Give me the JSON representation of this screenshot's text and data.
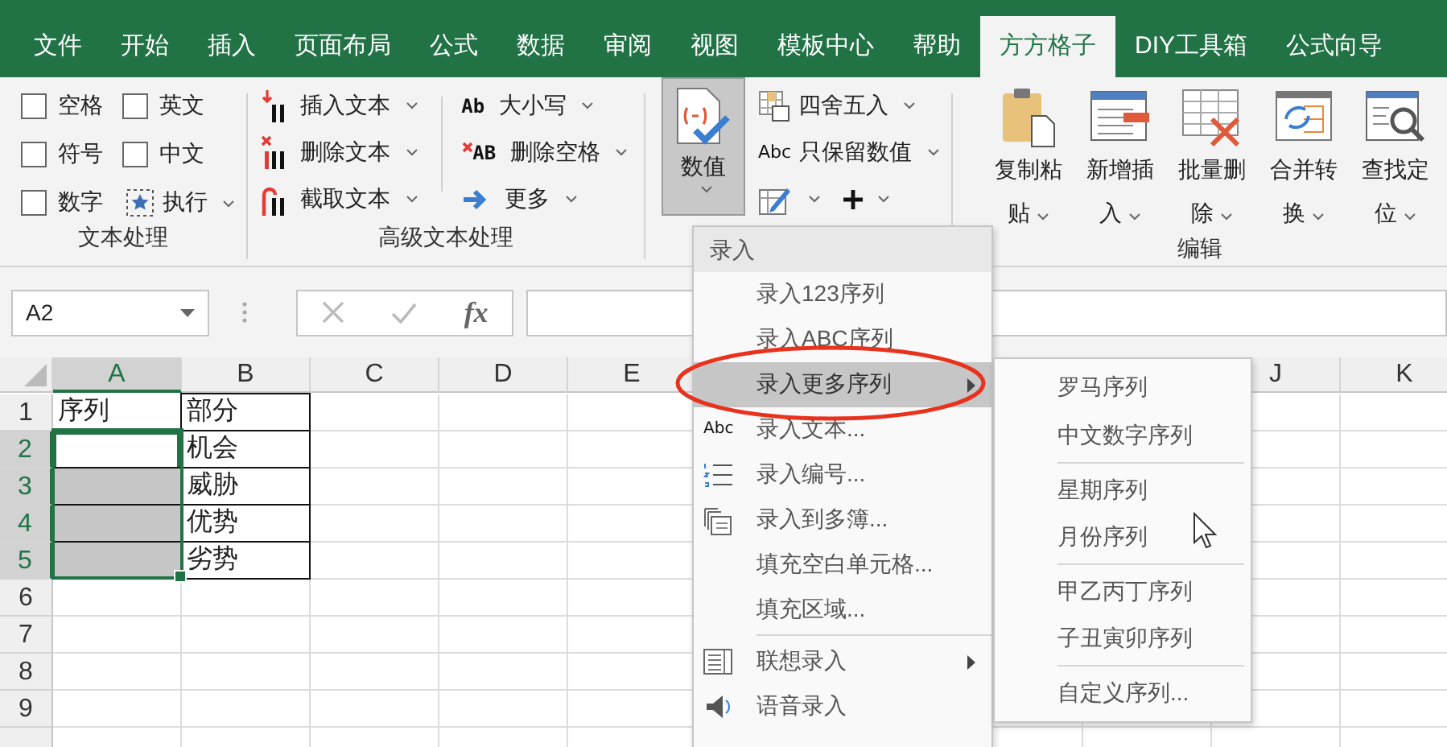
{
  "tabs": [
    {
      "label": "文件",
      "selected": false
    },
    {
      "label": "开始",
      "selected": false
    },
    {
      "label": "插入",
      "selected": false
    },
    {
      "label": "页面布局",
      "selected": false
    },
    {
      "label": "公式",
      "selected": false
    },
    {
      "label": "数据",
      "selected": false
    },
    {
      "label": "审阅",
      "selected": false
    },
    {
      "label": "视图",
      "selected": false
    },
    {
      "label": "模板中心",
      "selected": false
    },
    {
      "label": "帮助",
      "selected": false
    },
    {
      "label": "方方格子",
      "selected": true
    },
    {
      "label": "DIY工具箱",
      "selected": false
    },
    {
      "label": "公式向导",
      "selected": false
    }
  ],
  "ribbon": {
    "text_group": {
      "label": "文本处理",
      "checkboxes": [
        {
          "label": "空格",
          "checked": false
        },
        {
          "label": "英文",
          "checked": false
        },
        {
          "label": "符号",
          "checked": false
        },
        {
          "label": "中文",
          "checked": false
        },
        {
          "label": "数字",
          "checked": false
        }
      ],
      "run_button": {
        "label": "执行"
      }
    },
    "advanced_group": {
      "label": "高级文本处理",
      "columns": [
        [
          {
            "label": "插入文本"
          },
          {
            "label": "删除文本"
          },
          {
            "label": "截取文本"
          }
        ],
        [
          {
            "label": "大小写",
            "icon_text": "Ab"
          },
          {
            "label": "删除空格",
            "icon_text": "AB"
          },
          {
            "label": "更多"
          }
        ]
      ]
    },
    "value_group": {
      "main_button": {
        "label": "数值",
        "selected": true
      },
      "items": [
        {
          "label": "四舍五入"
        },
        {
          "label": "只保留数值",
          "icon_text": "Abc"
        }
      ]
    },
    "edit_group": {
      "label": "编辑",
      "buttons": [
        {
          "label": "复制粘贴"
        },
        {
          "label": "新增插入"
        },
        {
          "label": "批量删除"
        },
        {
          "label": "合并转换"
        },
        {
          "label": "查找定位"
        }
      ]
    }
  },
  "formula_bar": {
    "name_box": "A2",
    "function_label": "fx"
  },
  "sheet": {
    "columns": [
      "A",
      "B",
      "C",
      "D",
      "E"
    ],
    "right_columns": [
      "J",
      "K"
    ],
    "rows": [
      {
        "number": "1",
        "cells": [
          {
            "text": "序列",
            "bordered": false,
            "selected": false,
            "active": false
          },
          {
            "text": "部分",
            "bordered": true,
            "selected": false,
            "active": false
          }
        ]
      },
      {
        "number": "2",
        "cells": [
          {
            "bordered": true,
            "selected": false,
            "active": true
          },
          {
            "text": "机会",
            "bordered": true,
            "selected": false,
            "active": false
          }
        ]
      },
      {
        "number": "3",
        "cells": [
          {
            "bordered": true,
            "selected": true,
            "active": false
          },
          {
            "text": "威胁",
            "bordered": true,
            "selected": false,
            "active": false
          }
        ]
      },
      {
        "number": "4",
        "cells": [
          {
            "bordered": true,
            "selected": true,
            "active": false
          },
          {
            "text": "优势",
            "bordered": true,
            "selected": false,
            "active": false
          }
        ]
      },
      {
        "number": "5",
        "cells": [
          {
            "bordered": true,
            "selected": true,
            "active": false
          },
          {
            "text": "劣势",
            "bordered": true,
            "selected": false,
            "active": false
          }
        ]
      },
      {
        "number": "6",
        "cells": []
      },
      {
        "number": "7",
        "cells": []
      },
      {
        "number": "8",
        "cells": []
      },
      {
        "number": "9",
        "cells": []
      }
    ]
  },
  "menu": {
    "title": "录入",
    "items": [
      {
        "label": "录入123序列",
        "kind": "plain",
        "submenu": false,
        "selected": false,
        "separator_before": false
      },
      {
        "label": "录入ABC序列",
        "kind": "plain",
        "submenu": false,
        "selected": false,
        "separator_before": false
      },
      {
        "label": "录入更多序列",
        "kind": "plain",
        "submenu": true,
        "selected": true,
        "separator_before": false
      },
      {
        "label": "录入文本...",
        "kind": "text",
        "icon_text": "Abc",
        "submenu": false,
        "selected": false,
        "separator_before": false
      },
      {
        "label": "录入编号...",
        "kind": "numbering",
        "submenu": false,
        "selected": false,
        "separator_before": false
      },
      {
        "label": "录入到多簿...",
        "kind": "workbooks",
        "submenu": false,
        "selected": false,
        "separator_before": false
      },
      {
        "label": "填充空白单元格...",
        "kind": "plain",
        "submenu": false,
        "selected": false,
        "separator_before": false
      },
      {
        "label": "填充区域...",
        "kind": "plain",
        "submenu": false,
        "selected": false,
        "separator_before": false
      },
      {
        "label": "联想录入",
        "kind": "form",
        "submenu": true,
        "selected": false,
        "separator_before": true
      },
      {
        "label": "语音录入",
        "kind": "speaker",
        "submenu": false,
        "selected": false,
        "separator_before": false
      }
    ]
  },
  "submenu": {
    "items": [
      {
        "label": "罗马序列",
        "separator_before": false
      },
      {
        "label": "中文数字序列",
        "separator_before": false
      },
      {
        "label": "星期序列",
        "separator_before": true
      },
      {
        "label": "月份序列",
        "separator_before": false
      },
      {
        "label": "甲乙丙丁序列",
        "separator_before": true
      },
      {
        "label": "子丑寅卯序列",
        "separator_before": false
      },
      {
        "label": "自定义序列...",
        "separator_before": true
      }
    ]
  }
}
